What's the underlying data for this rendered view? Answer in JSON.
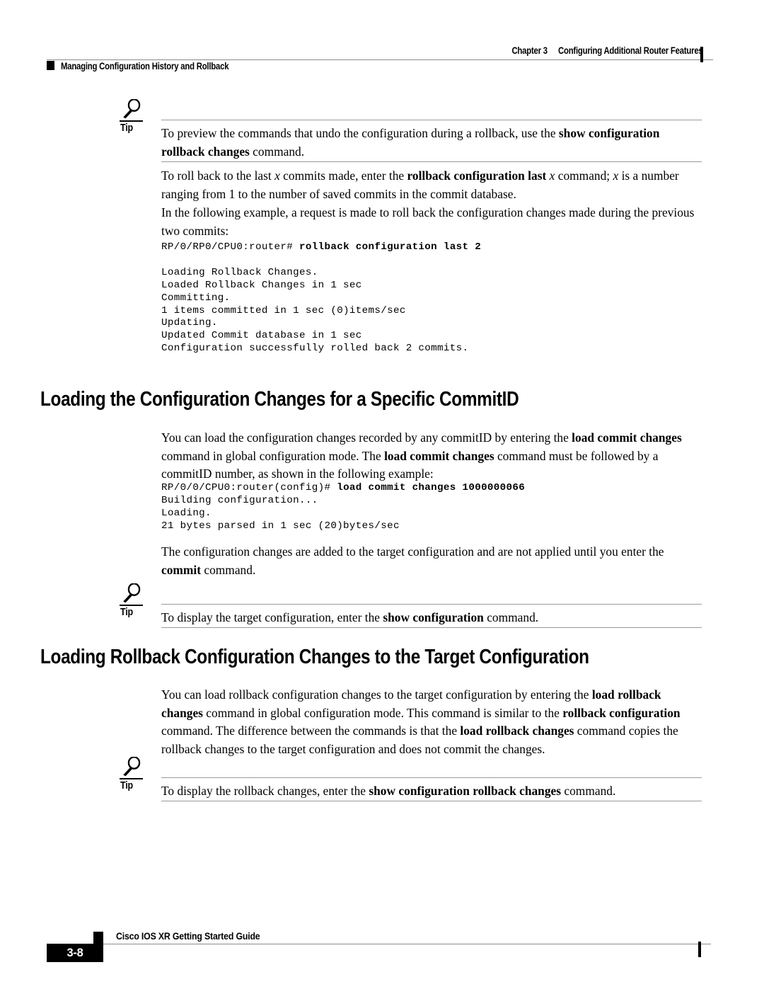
{
  "header": {
    "chapter_label": "Chapter 3",
    "chapter_title": "Configuring Additional Router Features",
    "section_title": "Managing Configuration History and Rollback"
  },
  "footer": {
    "page_number": "3-8",
    "guide_title": "Cisco IOS XR Getting Started Guide"
  },
  "tips": {
    "tip_label": "Tip",
    "tip1_html": "To preview the commands that undo the configuration during a rollback, use the <b>show configuration rollback changes</b> command.",
    "tip2_html": "To display the target configuration, enter the <b>show configuration</b> command.",
    "tip3_html": "To display the rollback changes, enter the <b>show configuration rollback changes</b> command."
  },
  "body": {
    "para1_html": "To roll back to the last <i>x</i> commits made, enter the <b>rollback configuration last</b> <i>x</i> command; <i>x</i> is a number ranging from 1 to the number of saved commits in the commit database.",
    "para2_html": "In the following example, a request is made to roll back the configuration changes made during the previous two commits:",
    "code1_lines": [
      "RP/0/RP0/CPU0:router# <b>rollback configuration last 2</b>",
      "",
      "Loading Rollback Changes.",
      "Loaded Rollback Changes in 1 sec",
      "Committing.",
      "1 items committed in 1 sec (0)items/sec",
      "Updating.",
      "Updated Commit database in 1 sec",
      "Configuration successfully rolled back 2 commits."
    ],
    "heading1": "Loading the Configuration Changes for a Specific CommitID",
    "para3_html": "You can load the configuration changes recorded by any commitID by entering the <b>load commit changes</b> command in global configuration mode. The <b>load commit changes</b> command must be followed by a commitID number, as shown in the following example:",
    "code2_lines": [
      "RP/0/0/CPU0:router(config)# <b>load commit changes 1000000066</b>",
      "Building configuration...",
      "Loading.",
      "21 bytes parsed in 1 sec (20)bytes/sec"
    ],
    "para4_html": "The configuration changes are added to the target configuration and are not applied until you enter the <b>commit</b> command.",
    "heading2": "Loading Rollback Configuration Changes to the Target Configuration",
    "para5_html": "You can load rollback configuration changes to the target configuration by entering the <b>load rollback changes</b> command in global configuration mode. This command is similar to the <b>rollback configuration</b> command. The difference between the commands is that the <b>load rollback changes</b> command copies the rollback changes to the target configuration and does not commit the changes."
  }
}
